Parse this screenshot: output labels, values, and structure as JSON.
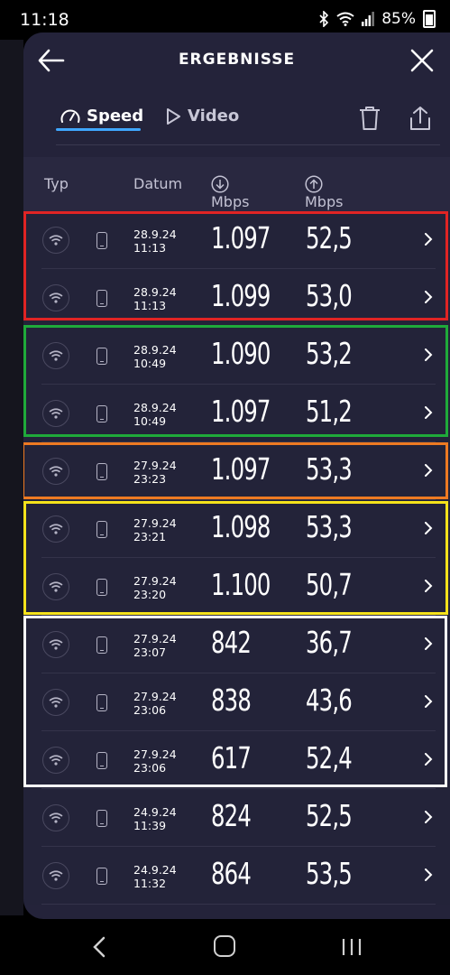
{
  "status": {
    "time": "11:18",
    "battery": "85%"
  },
  "header": {
    "title": "ERGEBNISSE"
  },
  "tabs": [
    {
      "label": "Speed"
    },
    {
      "label": "Video"
    }
  ],
  "columns": {
    "type": "Typ",
    "date": "Datum",
    "download": "Mbps",
    "upload": "Mbps"
  },
  "colors": {
    "red": "#e02424",
    "green": "#1faa3a",
    "orange": "#ee7a22",
    "yellow": "#f5e21b",
    "white": "#ffffff",
    "accent": "#3fa7ff"
  },
  "rows": [
    {
      "date": "28.9.24",
      "time": "11:13",
      "download": "1.097",
      "upload": "52,5"
    },
    {
      "date": "28.9.24",
      "time": "11:13",
      "download": "1.099",
      "upload": "53,0"
    },
    {
      "date": "28.9.24",
      "time": "10:49",
      "download": "1.090",
      "upload": "53,2"
    },
    {
      "date": "28.9.24",
      "time": "10:49",
      "download": "1.097",
      "upload": "51,2"
    },
    {
      "date": "27.9.24",
      "time": "23:23",
      "download": "1.097",
      "upload": "53,3"
    },
    {
      "date": "27.9.24",
      "time": "23:21",
      "download": "1.098",
      "upload": "53,3"
    },
    {
      "date": "27.9.24",
      "time": "23:20",
      "download": "1.100",
      "upload": "50,7"
    },
    {
      "date": "27.9.24",
      "time": "23:07",
      "download": "842",
      "upload": "36,7"
    },
    {
      "date": "27.9.24",
      "time": "23:06",
      "download": "838",
      "upload": "43,6"
    },
    {
      "date": "27.9.24",
      "time": "23:06",
      "download": "617",
      "upload": "52,4"
    },
    {
      "date": "24.9.24",
      "time": "11:39",
      "download": "824",
      "upload": "52,5"
    },
    {
      "date": "24.9.24",
      "time": "11:32",
      "download": "864",
      "upload": "53,5"
    }
  ]
}
